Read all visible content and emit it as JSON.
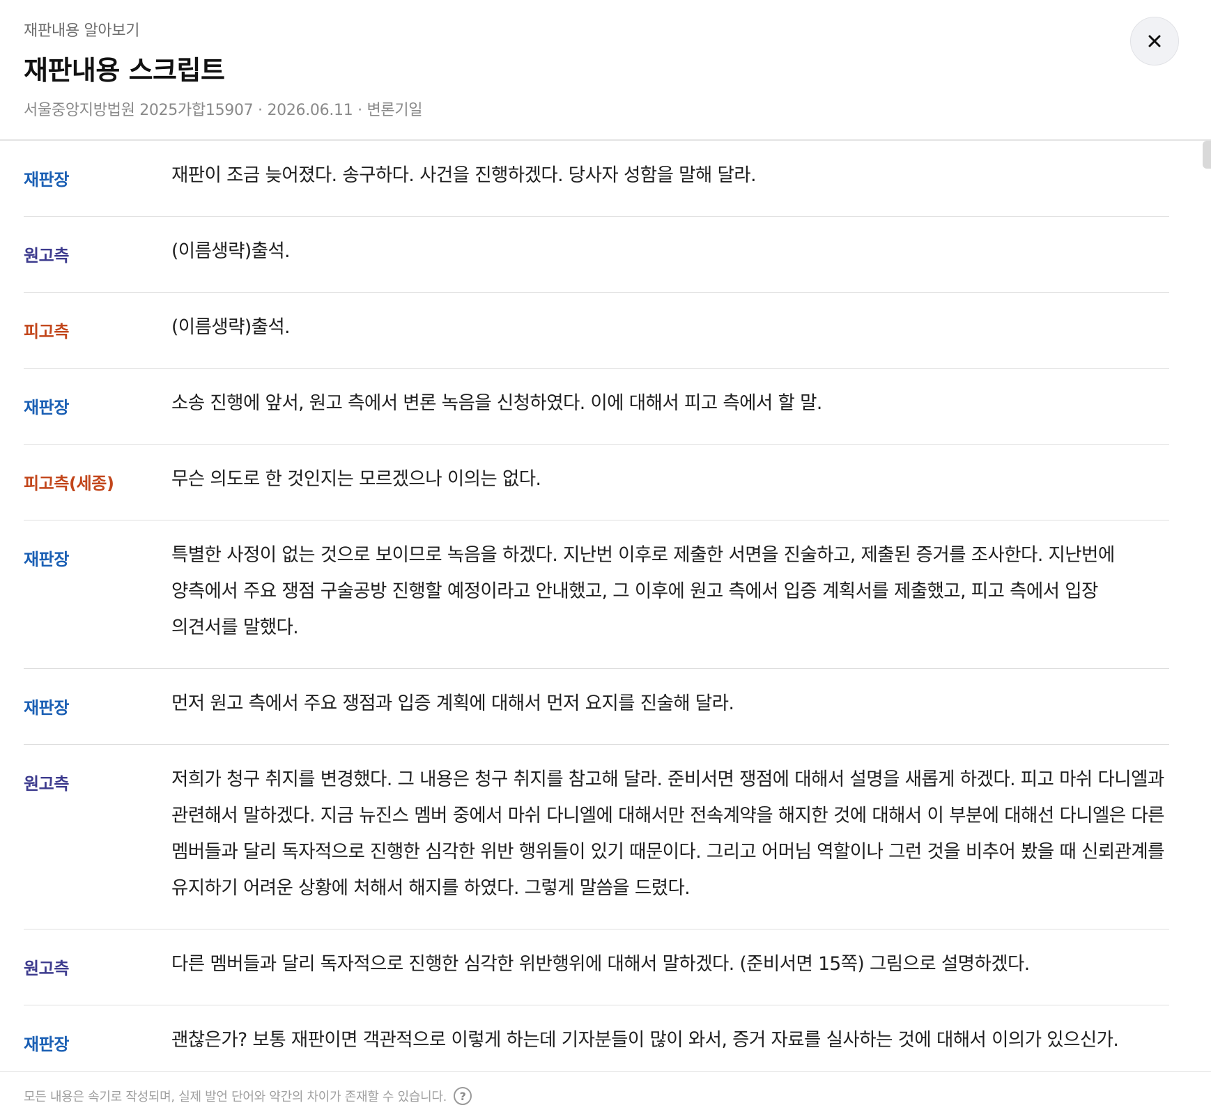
{
  "header": {
    "eyebrow": "재판내용 알아보기",
    "title": "재판내용 스크립트",
    "subtitle": "서울중앙지방법원 2025가합15907 · 2026.06.11 · 변론기일",
    "close_label": "×"
  },
  "transcript": [
    {
      "speaker": "재판장",
      "role": "judge",
      "text": "재판이 조금 늦어졌다. 송구하다. 사건을 진행하겠다. 당사자 성함을 말해 달라."
    },
    {
      "speaker": "원고측",
      "role": "plaintiff",
      "text": "(이름생략)출석."
    },
    {
      "speaker": "피고측",
      "role": "defendant",
      "text": "(이름생략)출석."
    },
    {
      "speaker": "재판장",
      "role": "judge",
      "text": "소송 진행에 앞서, 원고 측에서 변론 녹음을 신청하였다. 이에 대해서 피고 측에서 할 말."
    },
    {
      "speaker": "피고측(세종)",
      "role": "defendant",
      "text": "무슨 의도로 한 것인지는 모르겠으나 이의는 없다."
    },
    {
      "speaker": "재판장",
      "role": "judge",
      "text": "특별한 사정이 없는 것으로 보이므로 녹음을 하겠다. 지난번 이후로 제출한 서면을 진술하고, 제출된 증거를 조사한다. 지난번에 양측에서 주요 쟁점 구술공방 진행할 예정이라고 안내했고, 그 이후에 원고 측에서 입증 계획서를 제출했고, 피고 측에서 입장 의견서를 말했다."
    },
    {
      "speaker": "재판장",
      "role": "judge",
      "text": "먼저 원고 측에서 주요 쟁점과 입증 계획에 대해서 먼저 요지를 진술해 달라."
    },
    {
      "speaker": "원고측",
      "role": "plaintiff",
      "text": "저희가 청구 취지를 변경했다. 그 내용은 청구 취지를 참고해 달라. 준비서면 쟁점에 대해서 설명을 새롭게 하겠다. 피고 마쉬 다니엘과 관련해서 말하겠다. 지금 뉴진스 멤버 중에서 마쉬 다니엘에 대해서만 전속계약을 해지한 것에 대해서 이 부분에 대해선 다니엘은 다른 멤버들과 달리 독자적으로 진행한 심각한 위반 행위들이 있기 때문이다. 그리고 어머님 역할이나 그런 것을 비추어 봤을 때 신뢰관계를 유지하기 어려운 상황에 처해서 해지를 하였다. 그렇게 말씀을 드렸다."
    },
    {
      "speaker": "원고측",
      "role": "plaintiff",
      "text": "다른 멤버들과 달리 독자적으로 진행한 심각한 위반행위에 대해서 말하겠다. (준비서면 15쪽) 그림으로 설명하겠다."
    },
    {
      "speaker": "재판장",
      "role": "judge",
      "text": "괜찮은가? 보통 재판이면 객관적으로 이렇게 하는데 기자분들이 많이 와서, 증거 자료를 실사하는 것에 대해서 이의가 있으신가."
    }
  ],
  "footer": {
    "note": "모든 내용은 속기로 작성되며, 실제 발언 단어와 약간의 차이가 존재할 수 있습니다.",
    "help_label": "?"
  },
  "colors": {
    "judge": "#1a5fb4",
    "plaintiff": "#3d3b8e",
    "defendant": "#c2461b"
  }
}
